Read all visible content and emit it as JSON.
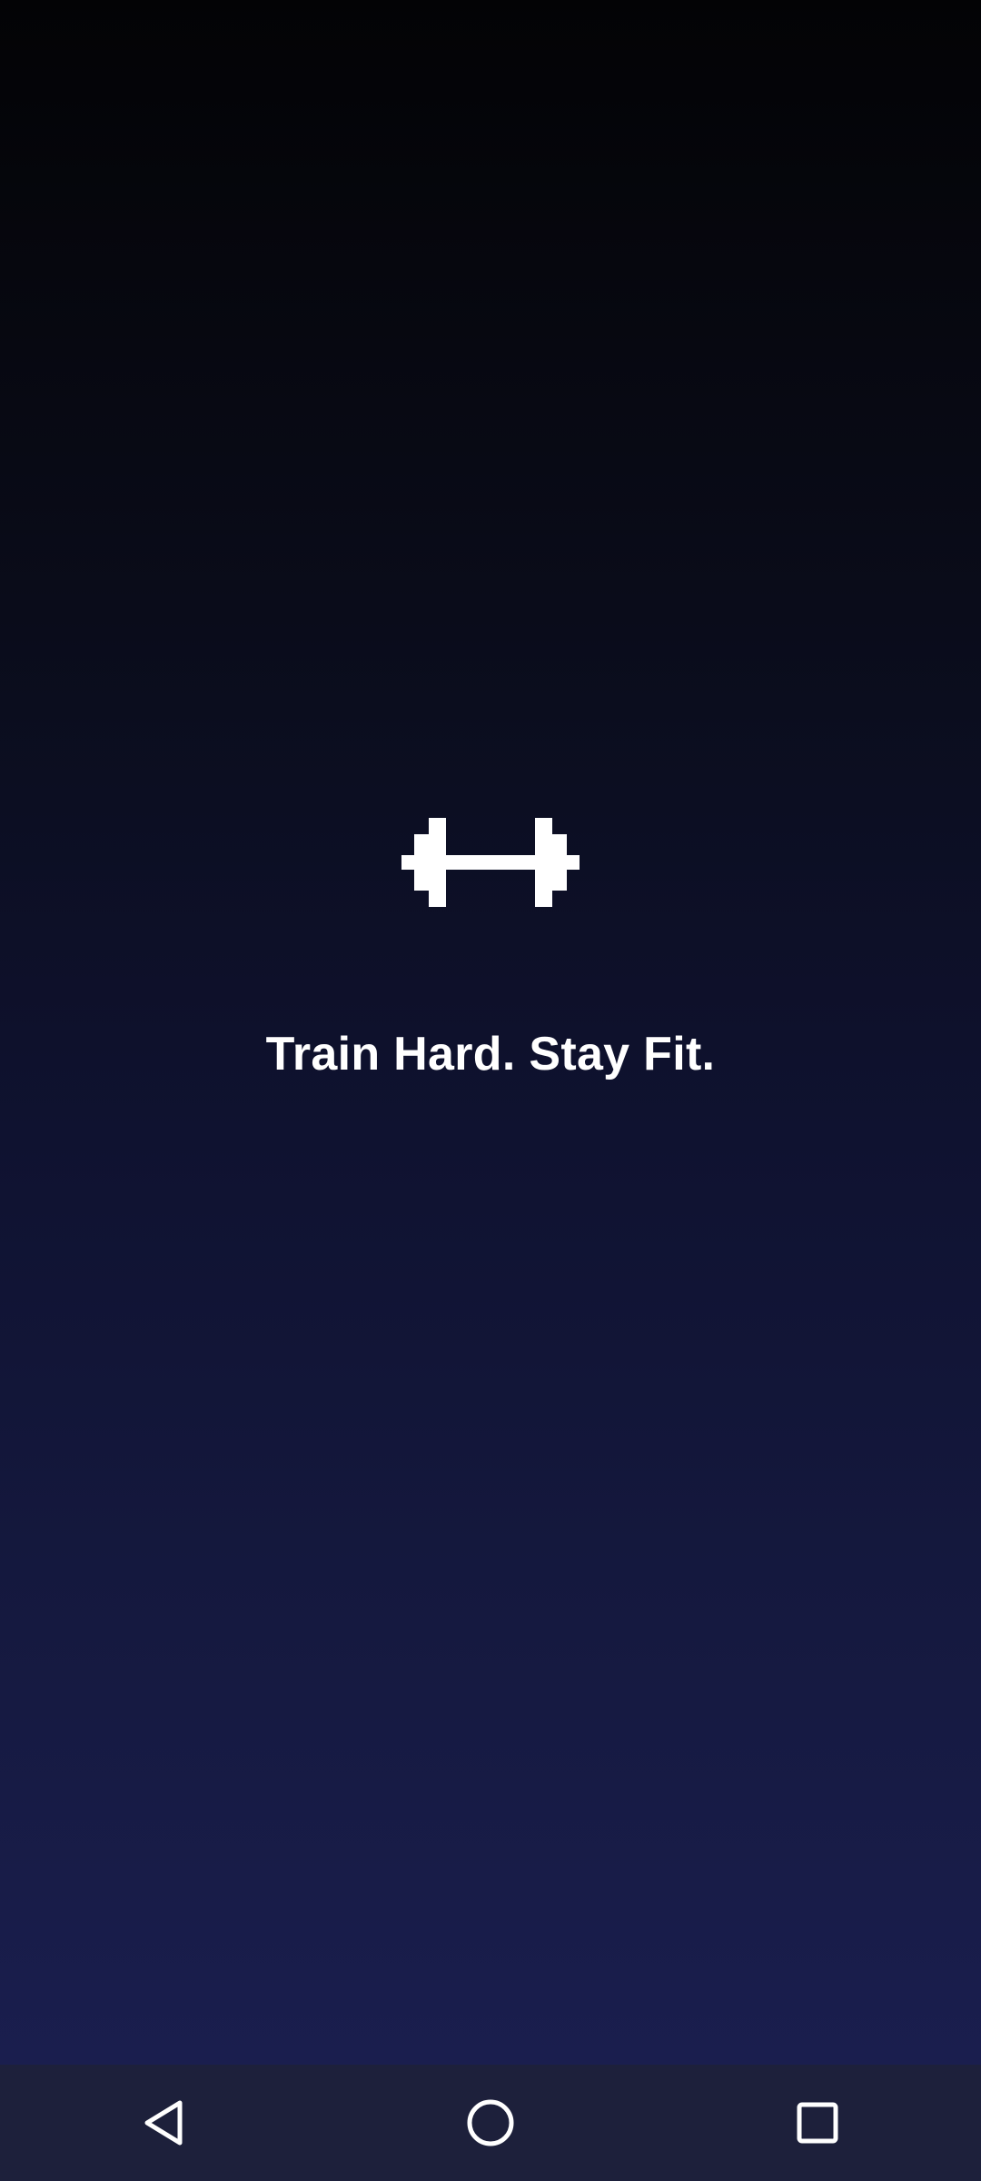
{
  "splash": {
    "logo_icon": "dumbbell-icon",
    "tagline": "Train Hard. Stay Fit."
  },
  "navbar": {
    "back_icon": "triangle-back-icon",
    "home_icon": "circle-home-icon",
    "recents_icon": "square-recents-icon"
  },
  "colors": {
    "background_top": "#030305",
    "background_bottom": "#1b1f52",
    "navbar": "#1d203b",
    "foreground": "#ffffff"
  }
}
